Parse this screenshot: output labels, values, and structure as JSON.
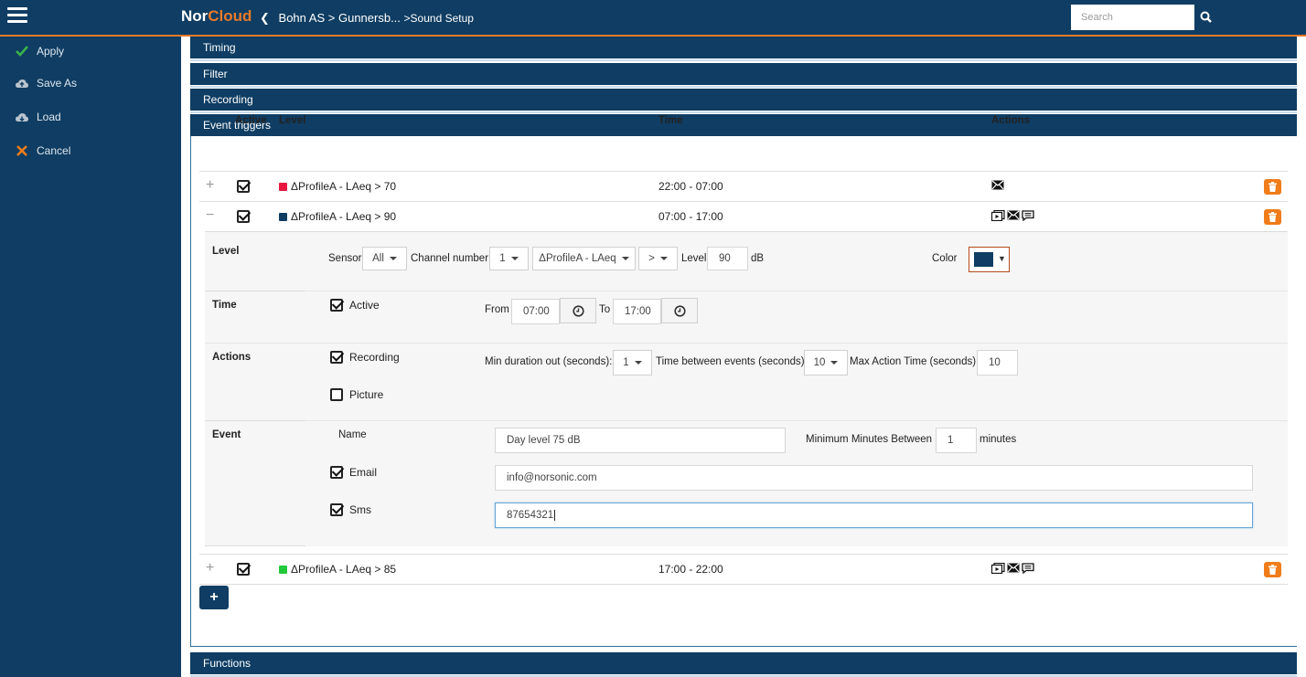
{
  "header": {
    "brand_nor": "Nor",
    "brand_cloud": "Cloud",
    "crumb_1": "Bohn AS",
    "crumb_sep": ">",
    "crumb_2": "Gunnersb...",
    "crumb_3": ">Sound Setup",
    "search_placeholder": "Search"
  },
  "sidebar": {
    "items": [
      {
        "label": "Apply",
        "icon": "check-icon"
      },
      {
        "label": "Save As",
        "icon": "cloud-upload-icon"
      },
      {
        "label": "Load",
        "icon": "cloud-download-icon"
      },
      {
        "label": "Cancel",
        "icon": "x-icon"
      }
    ]
  },
  "sections": {
    "timing": "Timing",
    "filter": "Filter",
    "recording": "Recording",
    "event_triggers": "Event triggers",
    "functions": "Functions"
  },
  "table": {
    "headers": {
      "active": "Active",
      "level": "Level",
      "time": "Time",
      "actions": "Actions"
    },
    "rows": [
      {
        "toggle": "+",
        "active": true,
        "color": "#e8163f",
        "level": "ΔProfileA - LAeq > 70",
        "time": "22:00 - 07:00",
        "actions": [
          "email-icon"
        ]
      },
      {
        "toggle": "−",
        "active": true,
        "color": "#0f3d63",
        "level": "ΔProfileA - LAeq > 90",
        "time": "07:00 - 17:00",
        "actions": [
          "video-icon",
          "email-icon",
          "sms-icon"
        ]
      },
      {
        "toggle": "+",
        "active": true,
        "color": "#22c93a",
        "level": "ΔProfileA - LAeq > 85",
        "time": "17:00 - 22:00",
        "actions": [
          "video-icon",
          "email-icon",
          "sms-icon"
        ]
      }
    ]
  },
  "detail": {
    "level": {
      "label": "Level",
      "sensor_label": "Sensor",
      "sensor_value": "All",
      "channel_label": "Channel number",
      "channel_value": "1",
      "profile_value": "ΔProfileA - LAeq",
      "operator_value": ">",
      "level_label": "Level",
      "level_value": "90",
      "unit": "dB",
      "color_label": "Color",
      "color_value": "#0f3d63"
    },
    "time": {
      "label": "Time",
      "active_label": "Active",
      "active": true,
      "from_label": "From",
      "from_value": "07:00",
      "to_label": "To",
      "to_value": "17:00"
    },
    "actions": {
      "label": "Actions",
      "recording_label": "Recording",
      "recording": true,
      "picture_label": "Picture",
      "picture": false,
      "min_duration_label": "Min duration out (seconds):",
      "min_duration_value": "1",
      "between_label": "Time between events (seconds):",
      "between_value": "10",
      "max_action_label": "Max Action Time (seconds):",
      "max_action_value": "10"
    },
    "event": {
      "label": "Event",
      "name_label": "Name",
      "name_value": "Day level 75 dB",
      "min_minutes_label": "Minimum Minutes Between",
      "min_minutes_value": "1",
      "minutes_unit": "minutes",
      "email_label": "Email",
      "email": true,
      "email_value": "info@norsonic.com",
      "sms_label": "Sms",
      "sms": true,
      "sms_value": "87654321"
    }
  },
  "add_button": "+"
}
